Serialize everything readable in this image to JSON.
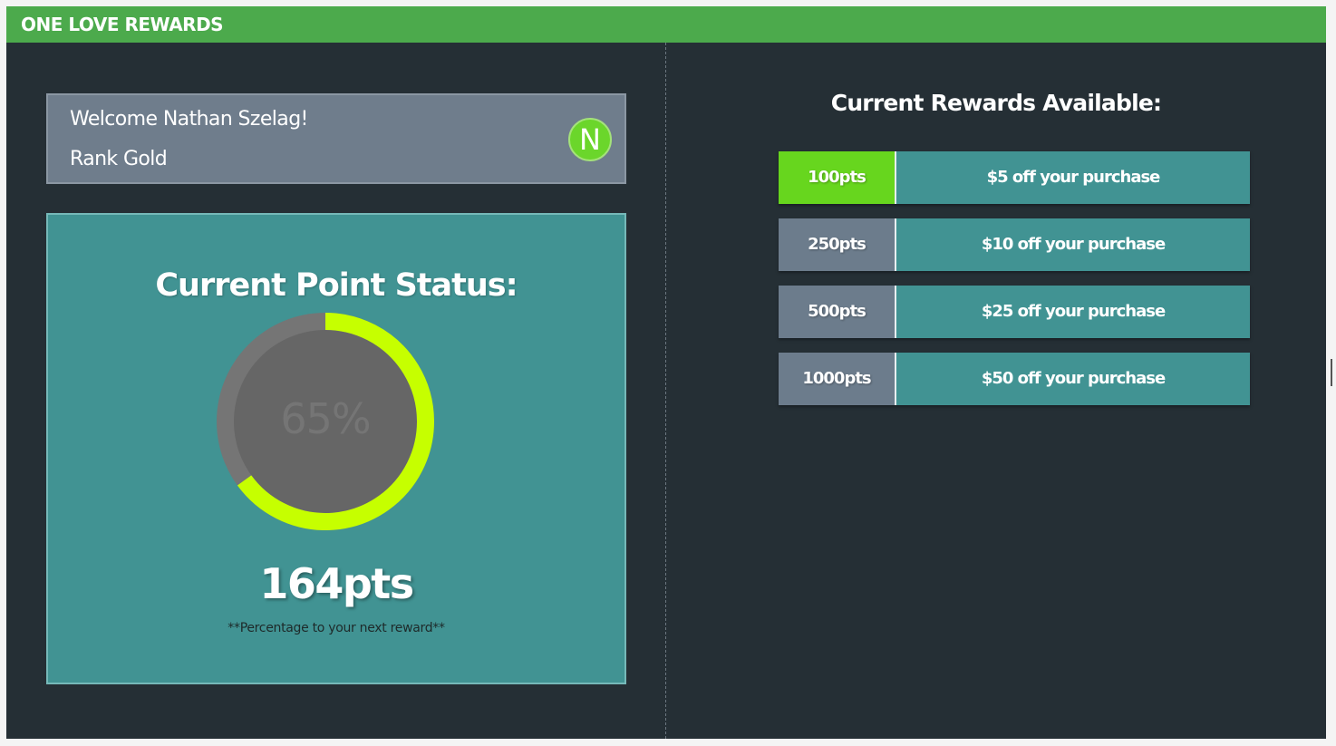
{
  "header": {
    "title": "ONE LOVE REWARDS"
  },
  "profile": {
    "welcome": "Welcome Nathan Szelag!",
    "rank": "Rank Gold",
    "avatar_letter": "N"
  },
  "points": {
    "title": "Current Point Status:",
    "progress_percent": 65,
    "progress_label": "65%",
    "value": "164pts",
    "note": "**Percentage to your next reward**"
  },
  "rewards": {
    "title": "Current Rewards Available:",
    "items": [
      {
        "points": "100pts",
        "description": "$5 off your purchase",
        "unlocked": true
      },
      {
        "points": "250pts",
        "description": "$10 off your purchase",
        "unlocked": false
      },
      {
        "points": "500pts",
        "description": "$25 off your purchase",
        "unlocked": false
      },
      {
        "points": "1000pts",
        "description": "$50 off your purchase",
        "unlocked": false
      }
    ]
  },
  "colors": {
    "header": "#4caa4c",
    "background": "#252f35",
    "card_teal": "#419393",
    "card_slate": "#6f7d8c",
    "progress": "#c6ff00",
    "unlocked": "#67d61e"
  }
}
